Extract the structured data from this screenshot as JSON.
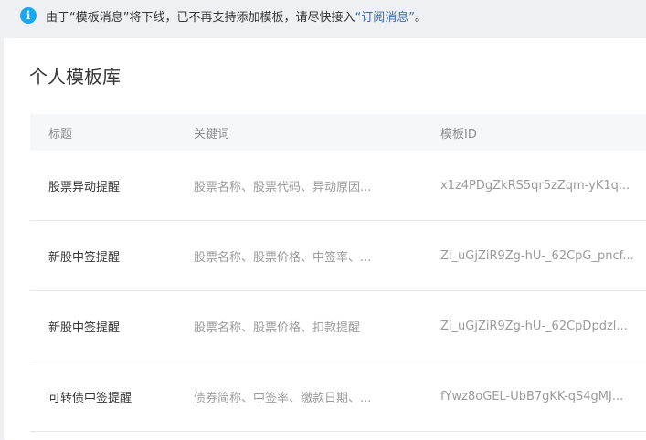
{
  "notice": {
    "icon": "info-icon",
    "icon_glyph": "i",
    "text_before": "由于“模板消息”将下线，已不再支持添加模板，请尽快接入",
    "link_text": "“订阅消息”",
    "text_after": "。",
    "icon_color": "#1aa8f0",
    "link_color": "#3b6bb5"
  },
  "page": {
    "title": "个人模板库"
  },
  "table": {
    "headers": {
      "title": "标题",
      "keywords": "关键词",
      "template_id": "模板ID"
    },
    "rows": [
      {
        "title": "股票异动提醒",
        "keywords": "股票名称、股票代码、异动原因...",
        "template_id": "x1z4PDgZkRS5qr5zZqm-yK1q..."
      },
      {
        "title": "新股中签提醒",
        "keywords": "股票名称、股票价格、中签率、...",
        "template_id": "Zi_uGjZiR9Zg-hU-_62CpG_pncf..."
      },
      {
        "title": "新股中签提醒",
        "keywords": "股票名称、股票价格、扣款提醒",
        "template_id": "Zi_uGjZiR9Zg-hU-_62CpDpdzl..."
      },
      {
        "title": "可转债中签提醒",
        "keywords": "债券简称、中签率、缴款日期、...",
        "template_id": "fYwz8oGEL-UbB7gKK-qS4gMJ..."
      }
    ]
  }
}
